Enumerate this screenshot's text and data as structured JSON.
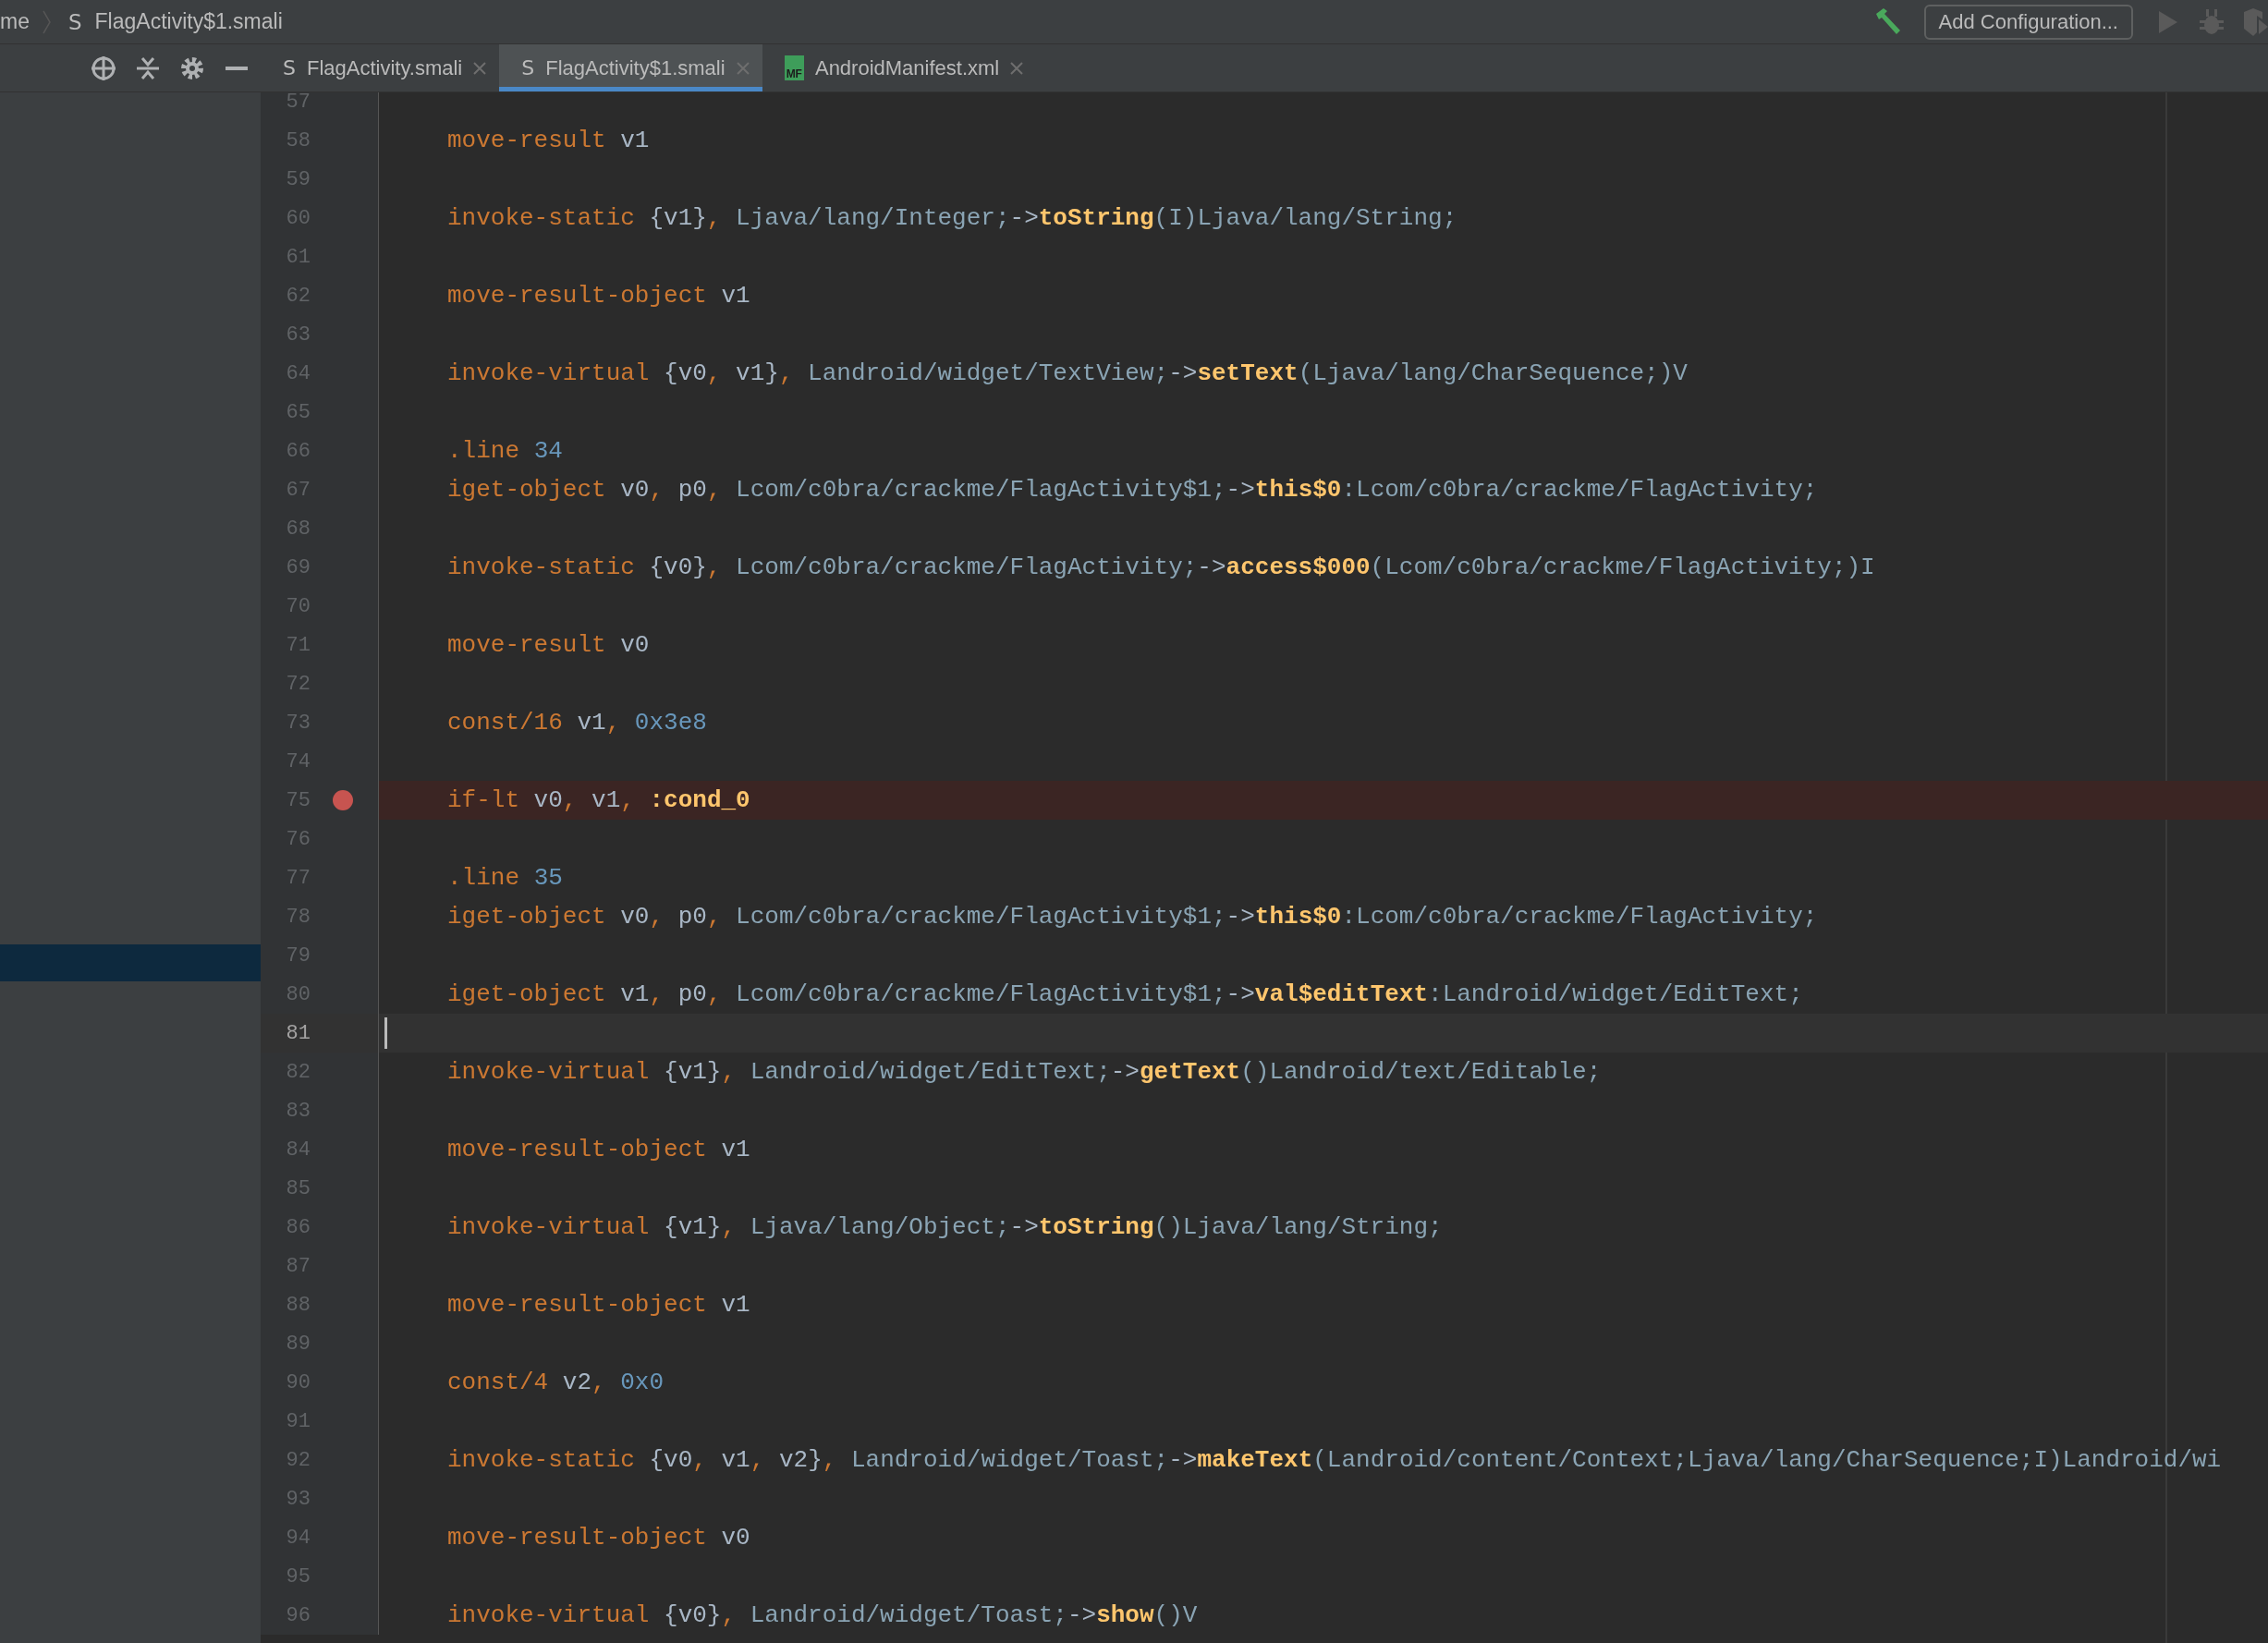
{
  "breadcrumb": {
    "parent": "me",
    "file_glyph": "S",
    "file": "FlagActivity$1.smali"
  },
  "toolbar": {
    "config_button": "Add Configuration..."
  },
  "project_panel": {
    "highlighted_row": true
  },
  "tabs": [
    {
      "label": "FlagActivity.smali",
      "file_glyph": "S",
      "kind": "smali",
      "selected": false
    },
    {
      "label": "FlagActivity$1.smali",
      "file_glyph": "S",
      "kind": "smali",
      "selected": true
    },
    {
      "label": "AndroidManifest.xml",
      "file_glyph": "MF",
      "kind": "manifest",
      "selected": false
    }
  ],
  "lines": [
    {
      "number": "57"
    },
    {
      "number": "58",
      "tokens": [
        {
          "kind": "kw",
          "text": "move-result"
        },
        {
          "kind": "reg",
          "text": " v1"
        }
      ]
    },
    {
      "number": "59"
    },
    {
      "number": "60",
      "tokens": [
        {
          "kind": "kw",
          "text": "invoke-static"
        },
        {
          "kind": "reg",
          "text": " {v1}"
        },
        {
          "kind": "sep",
          "text": ", "
        },
        {
          "kind": "type",
          "text": "Ljava/lang/Integer;"
        },
        {
          "kind": "reg",
          "text": "->"
        },
        {
          "kind": "method",
          "text": "toString"
        },
        {
          "kind": "type",
          "text": "(I)Ljava/lang/String;"
        }
      ]
    },
    {
      "number": "61"
    },
    {
      "number": "62",
      "tokens": [
        {
          "kind": "kw",
          "text": "move-result-object"
        },
        {
          "kind": "reg",
          "text": " v1"
        }
      ]
    },
    {
      "number": "63"
    },
    {
      "number": "64",
      "tokens": [
        {
          "kind": "kw",
          "text": "invoke-virtual"
        },
        {
          "kind": "reg",
          "text": " {v0"
        },
        {
          "kind": "sep",
          "text": ", "
        },
        {
          "kind": "reg",
          "text": "v1}"
        },
        {
          "kind": "sep",
          "text": ", "
        },
        {
          "kind": "type",
          "text": "Landroid/widget/TextView;"
        },
        {
          "kind": "reg",
          "text": "->"
        },
        {
          "kind": "method",
          "text": "setText"
        },
        {
          "kind": "type",
          "text": "(Ljava/lang/CharSequence;)V"
        }
      ]
    },
    {
      "number": "65"
    },
    {
      "number": "66",
      "tokens": [
        {
          "kind": "kw",
          "text": ".line "
        },
        {
          "kind": "num",
          "text": "34"
        }
      ]
    },
    {
      "number": "67",
      "tokens": [
        {
          "kind": "kw",
          "text": "iget-object"
        },
        {
          "kind": "reg",
          "text": " v0"
        },
        {
          "kind": "sep",
          "text": ", "
        },
        {
          "kind": "reg",
          "text": "p0"
        },
        {
          "kind": "sep",
          "text": ", "
        },
        {
          "kind": "type",
          "text": "Lcom/c0bra/crackme/FlagActivity$1;"
        },
        {
          "kind": "reg",
          "text": "->"
        },
        {
          "kind": "method",
          "text": "this$0"
        },
        {
          "kind": "type",
          "text": ":Lcom/c0bra/crackme/FlagActivity;"
        }
      ]
    },
    {
      "number": "68"
    },
    {
      "number": "69",
      "tokens": [
        {
          "kind": "kw",
          "text": "invoke-static"
        },
        {
          "kind": "reg",
          "text": " {v0}"
        },
        {
          "kind": "sep",
          "text": ", "
        },
        {
          "kind": "type",
          "text": "Lcom/c0bra/crackme/FlagActivity;"
        },
        {
          "kind": "reg",
          "text": "->"
        },
        {
          "kind": "method",
          "text": "access$000"
        },
        {
          "kind": "type",
          "text": "(Lcom/c0bra/crackme/FlagActivity;)I"
        }
      ]
    },
    {
      "number": "70"
    },
    {
      "number": "71",
      "tokens": [
        {
          "kind": "kw",
          "text": "move-result"
        },
        {
          "kind": "reg",
          "text": " v0"
        }
      ]
    },
    {
      "number": "72"
    },
    {
      "number": "73",
      "tokens": [
        {
          "kind": "kw",
          "text": "const/16"
        },
        {
          "kind": "reg",
          "text": " v1"
        },
        {
          "kind": "sep",
          "text": ", "
        },
        {
          "kind": "num",
          "text": "0x3e8"
        }
      ]
    },
    {
      "number": "74"
    },
    {
      "number": "75",
      "breakpoint": true,
      "tokens": [
        {
          "kind": "kw",
          "text": "if-lt"
        },
        {
          "kind": "reg",
          "text": " v0"
        },
        {
          "kind": "sep",
          "text": ", "
        },
        {
          "kind": "reg",
          "text": "v1"
        },
        {
          "kind": "sep",
          "text": ", "
        },
        {
          "kind": "method",
          "text": ":cond_0"
        }
      ]
    },
    {
      "number": "76"
    },
    {
      "number": "77",
      "tokens": [
        {
          "kind": "kw",
          "text": ".line "
        },
        {
          "kind": "num",
          "text": "35"
        }
      ]
    },
    {
      "number": "78",
      "tokens": [
        {
          "kind": "kw",
          "text": "iget-object"
        },
        {
          "kind": "reg",
          "text": " v0"
        },
        {
          "kind": "sep",
          "text": ", "
        },
        {
          "kind": "reg",
          "text": "p0"
        },
        {
          "kind": "sep",
          "text": ", "
        },
        {
          "kind": "type",
          "text": "Lcom/c0bra/crackme/FlagActivity$1;"
        },
        {
          "kind": "reg",
          "text": "->"
        },
        {
          "kind": "method",
          "text": "this$0"
        },
        {
          "kind": "type",
          "text": ":Lcom/c0bra/crackme/FlagActivity;"
        }
      ]
    },
    {
      "number": "79"
    },
    {
      "number": "80",
      "tokens": [
        {
          "kind": "kw",
          "text": "iget-object"
        },
        {
          "kind": "reg",
          "text": " v1"
        },
        {
          "kind": "sep",
          "text": ", "
        },
        {
          "kind": "reg",
          "text": "p0"
        },
        {
          "kind": "sep",
          "text": ", "
        },
        {
          "kind": "type",
          "text": "Lcom/c0bra/crackme/FlagActivity$1;"
        },
        {
          "kind": "reg",
          "text": "->"
        },
        {
          "kind": "method",
          "text": "val$editText"
        },
        {
          "kind": "type",
          "text": ":Landroid/widget/EditText;"
        }
      ]
    },
    {
      "number": "81",
      "current": true
    },
    {
      "number": "82",
      "tokens": [
        {
          "kind": "kw",
          "text": "invoke-virtual"
        },
        {
          "kind": "reg",
          "text": " {v1}"
        },
        {
          "kind": "sep",
          "text": ", "
        },
        {
          "kind": "type",
          "text": "Landroid/widget/EditText;"
        },
        {
          "kind": "reg",
          "text": "->"
        },
        {
          "kind": "method",
          "text": "getText"
        },
        {
          "kind": "type",
          "text": "()Landroid/text/Editable;"
        }
      ]
    },
    {
      "number": "83"
    },
    {
      "number": "84",
      "tokens": [
        {
          "kind": "kw",
          "text": "move-result-object"
        },
        {
          "kind": "reg",
          "text": " v1"
        }
      ]
    },
    {
      "number": "85"
    },
    {
      "number": "86",
      "tokens": [
        {
          "kind": "kw",
          "text": "invoke-virtual"
        },
        {
          "kind": "reg",
          "text": " {v1}"
        },
        {
          "kind": "sep",
          "text": ", "
        },
        {
          "kind": "type",
          "text": "Ljava/lang/Object;"
        },
        {
          "kind": "reg",
          "text": "->"
        },
        {
          "kind": "method",
          "text": "toString"
        },
        {
          "kind": "type",
          "text": "()Ljava/lang/String;"
        }
      ]
    },
    {
      "number": "87"
    },
    {
      "number": "88",
      "tokens": [
        {
          "kind": "kw",
          "text": "move-result-object"
        },
        {
          "kind": "reg",
          "text": " v1"
        }
      ]
    },
    {
      "number": "89"
    },
    {
      "number": "90",
      "tokens": [
        {
          "kind": "kw",
          "text": "const/4"
        },
        {
          "kind": "reg",
          "text": " v2"
        },
        {
          "kind": "sep",
          "text": ", "
        },
        {
          "kind": "num",
          "text": "0x0"
        }
      ]
    },
    {
      "number": "91"
    },
    {
      "number": "92",
      "tokens": [
        {
          "kind": "kw",
          "text": "invoke-static"
        },
        {
          "kind": "reg",
          "text": " {v0"
        },
        {
          "kind": "sep",
          "text": ", "
        },
        {
          "kind": "reg",
          "text": "v1"
        },
        {
          "kind": "sep",
          "text": ", "
        },
        {
          "kind": "reg",
          "text": "v2}"
        },
        {
          "kind": "sep",
          "text": ", "
        },
        {
          "kind": "type",
          "text": "Landroid/widget/Toast;"
        },
        {
          "kind": "reg",
          "text": "->"
        },
        {
          "kind": "method",
          "text": "makeText"
        },
        {
          "kind": "type",
          "text": "(Landroid/content/Context;Ljava/lang/CharSequence;I)Landroid/wi"
        }
      ]
    },
    {
      "number": "93"
    },
    {
      "number": "94",
      "tokens": [
        {
          "kind": "kw",
          "text": "move-result-object"
        },
        {
          "kind": "reg",
          "text": " v0"
        }
      ]
    },
    {
      "number": "95"
    },
    {
      "number": "96",
      "tokens": [
        {
          "kind": "kw",
          "text": "invoke-virtual"
        },
        {
          "kind": "reg",
          "text": " {v0}"
        },
        {
          "kind": "sep",
          "text": ", "
        },
        {
          "kind": "type",
          "text": "Landroid/widget/Toast;"
        },
        {
          "kind": "reg",
          "text": "->"
        },
        {
          "kind": "method",
          "text": "show"
        },
        {
          "kind": "type",
          "text": "()V"
        }
      ]
    }
  ]
}
